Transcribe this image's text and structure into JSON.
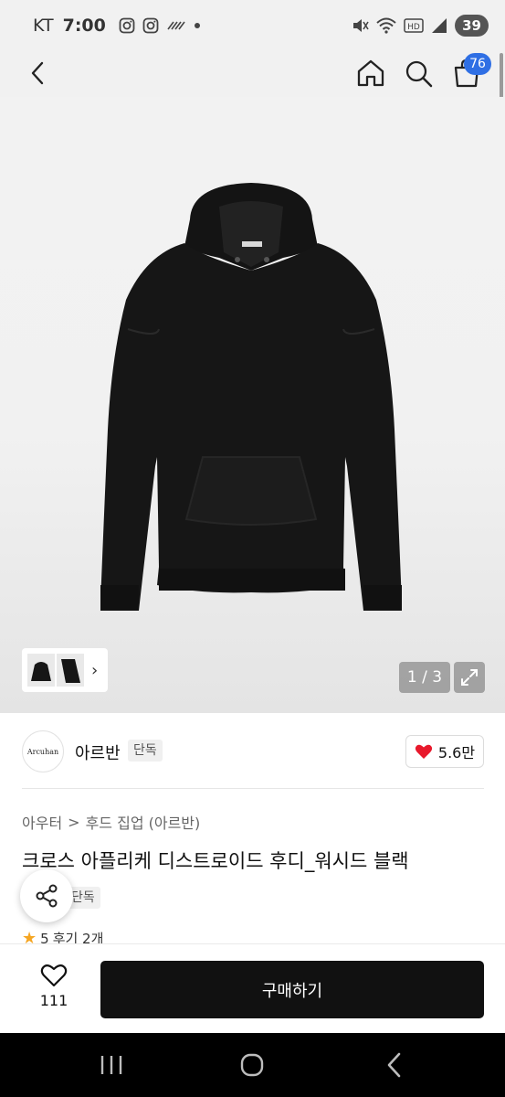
{
  "status_bar": {
    "carrier": "KT",
    "time": "7:00",
    "battery": "39"
  },
  "header": {
    "cart_badge": "76"
  },
  "gallery": {
    "counter": "1 / 3",
    "thumb_chevron": "›"
  },
  "brand": {
    "logo_text": "Arcuhan",
    "name": "아르반",
    "tag": "단독"
  },
  "like": {
    "count": "5.6만",
    "color": "#e8192c"
  },
  "product": {
    "breadcrumb": [
      "아우터",
      "후드 집업 (아르반)"
    ],
    "breadcrumb_separator": ">",
    "title": "크로스 아플리케 디스트로이드 후디_워시드 블랙",
    "exclusive_tag": "단독",
    "rating": "5",
    "reviews": "후기 2개"
  },
  "bottom_bar": {
    "wish_count": "111",
    "buy_label": "구매하기"
  },
  "icons": {
    "back": "back-icon",
    "home": "home-icon",
    "search": "search-icon",
    "cart": "cart-icon",
    "share": "share-icon",
    "heart": "heart-icon",
    "expand": "expand-icon"
  }
}
